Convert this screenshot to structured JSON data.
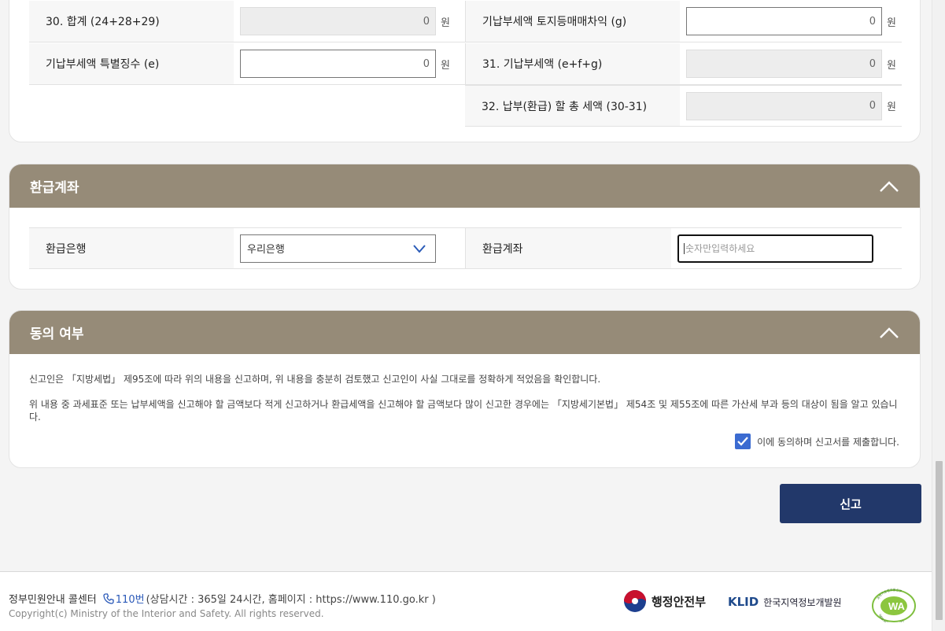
{
  "tax_section": {
    "rows": [
      {
        "left_label": "30. 합계 (24+28+29)",
        "left_value": "0",
        "right_label": "기납부세액 토지등매매차익 (g)",
        "right_value": "0"
      },
      {
        "left_label": "기납부세액 특별징수 (e)",
        "left_value": "0",
        "right_label": "31. 기납부세액 (e+f+g)",
        "right_value": "0"
      },
      {
        "right_label": "32. 납부(환급) 할 총 세액 (30-31)",
        "right_value": "0"
      }
    ],
    "unit": "원"
  },
  "refund_panel": {
    "title": "환급계좌",
    "bank_label": "환급은행",
    "bank_value": "우리은행",
    "account_label": "환급계좌",
    "account_placeholder": "숫자만입력하세요"
  },
  "consent_panel": {
    "title": "동의 여부",
    "paragraph1": "신고인은 「지방세법」 제95조에 따라 위의 내용을 신고하며, 위 내용을 충분히 검토했고 신고인이 사실 그대로를 정확하게 적었음을 확인합니다.",
    "paragraph2": "위 내용 중 과세표준 또는 납부세액을 신고해야 할 금액보다 적게 신고하거나 환급세액을 신고해야 할 금액보다 많이 신고한 경우에는 「지방세기본법」 제54조 및 제55조에 따른 가산세 부과 등의 대상이 됨을 알고 있습니다.",
    "checkbox_label": "이에 동의하며 신고서를 제출합니다.",
    "checked": true
  },
  "submit_label": "신고",
  "footer": {
    "call_center": "정부민원안내 콜센터",
    "phone": "110번",
    "hours": "(상담시간 : 365일 24시간, 홈페이지 : https://www.110.go.kr )",
    "copyright": "Copyright(c) Ministry of the Interior and Safety. All rights reserved.",
    "ministry_logo": "행정안전부",
    "klid_mark": "KLID",
    "klid_name": "한국지역정보개발원",
    "wa_mark": "WA",
    "wa_arc_top": "과학기술정보통신부",
    "wa_arc_bottom": "WEB ACCESSIBILITY"
  },
  "colors": {
    "panel_header": "#968b78",
    "submit_button": "#22386a",
    "checkbox": "#3b6bd1"
  },
  "icons": [
    "chevron-up-icon",
    "chevron-down-icon",
    "checkmark-icon",
    "phone-icon",
    "ministry-logo",
    "klid-logo",
    "wa-certification-logo"
  ]
}
